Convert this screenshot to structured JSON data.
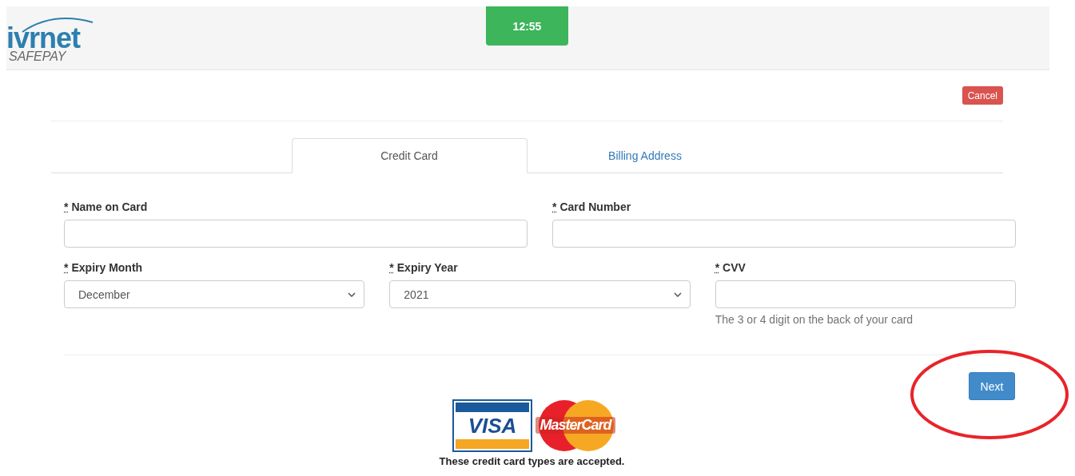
{
  "header": {
    "logo": {
      "name": "ivrnet",
      "subtitle": "SAFEPAY"
    },
    "timer": "12:55"
  },
  "cancel_button": "Cancel",
  "tabs": [
    {
      "label": "Credit Card",
      "selected": true
    },
    {
      "label": "Billing Address",
      "selected": false
    }
  ],
  "fields": [
    {
      "kind": "text",
      "mark": "*",
      "label": "Name on Card"
    },
    {
      "kind": "text",
      "mark": "*",
      "label": "Card Number"
    },
    {
      "kind": "select",
      "mark": "*",
      "label": "Expiry Month",
      "value": "December"
    },
    {
      "kind": "select",
      "mark": "*",
      "label": "Expiry Year",
      "value": "2021"
    },
    {
      "kind": "text",
      "mark": "*",
      "label": "CVV",
      "help": "The 3 or 4 digit on the back of your card"
    }
  ],
  "next_button": "Next",
  "annotation": {
    "kind": "ellipse"
  },
  "card_logos": [
    {
      "kind": "visa",
      "text": "VISA"
    },
    {
      "kind": "mastercard",
      "text": "MasterCard"
    }
  ],
  "accepted_note": "These credit card types are accepted."
}
